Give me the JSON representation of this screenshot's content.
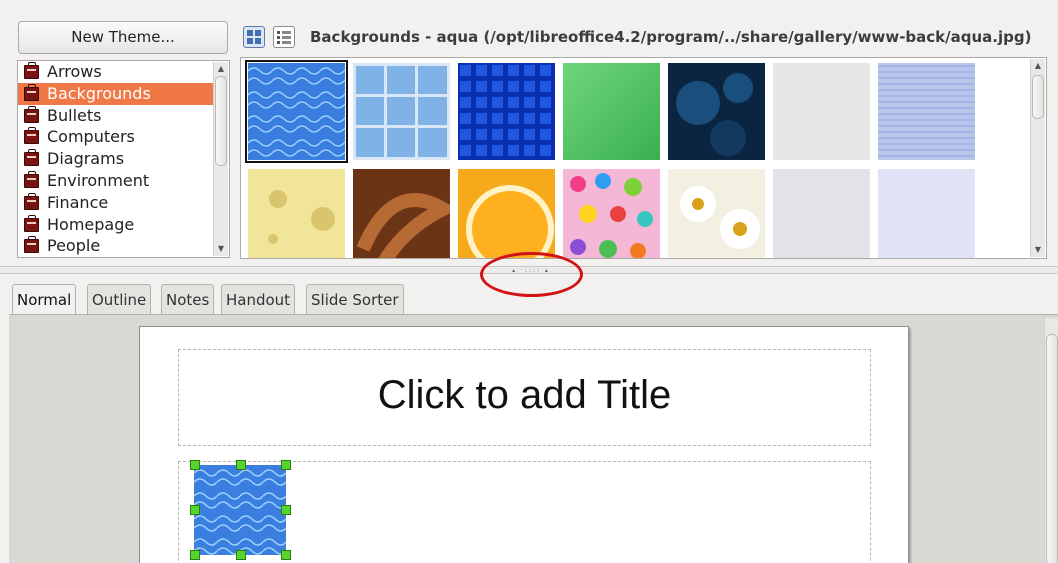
{
  "gallery": {
    "new_theme_label": "New Theme...",
    "title": "Backgrounds - aqua (/opt/libreoffice4.2/program/../share/gallery/www-back/aqua.jpg)",
    "themes": [
      "Arrows",
      "Backgrounds",
      "Bullets",
      "Computers",
      "Diagrams",
      "Environment",
      "Finance",
      "Homepage",
      "People"
    ],
    "selected_theme": "Backgrounds",
    "selected_image": "aqua",
    "thumbnail_names": [
      "aqua",
      "blue-tiles",
      "blue-squares",
      "green-texture",
      "dark-bubbles",
      "white-paper",
      "blue-fabric",
      "cheese",
      "chocolate-swirl",
      "orange-slice",
      "confetti-dots",
      "daisies",
      "white-crumple",
      "lavender-texture"
    ],
    "view_modes": [
      "icon-view",
      "detailed-view"
    ],
    "active_view": "icon-view"
  },
  "tabs": [
    "Normal",
    "Outline",
    "Notes",
    "Handout",
    "Slide Sorter"
  ],
  "active_tab": "Normal",
  "slide": {
    "title_placeholder": "Click to add Title",
    "inserted_image": "aqua"
  },
  "colors": {
    "selection": "#f07746",
    "annotation": "#d21317",
    "handle": "#55d52a"
  }
}
